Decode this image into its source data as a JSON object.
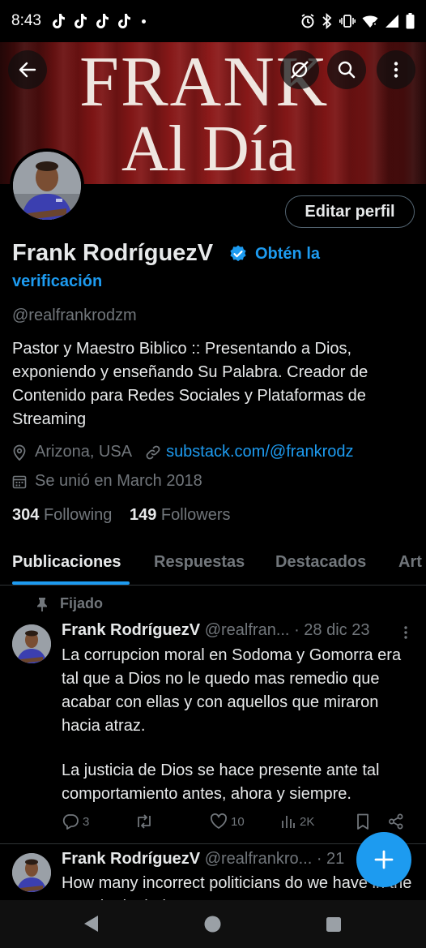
{
  "status_bar": {
    "time": "8:43"
  },
  "banner": {
    "line1": "FRANK",
    "line2": "Al Día"
  },
  "profile": {
    "edit_label": "Editar perfil",
    "name": "Frank RodríguezV",
    "verify_line1": "Obtén la",
    "verify_line2": "verificación",
    "handle": "@realfrankrodzm",
    "bio": "Pastor y Maestro Biblico :: Presentando a Dios, exponiendo y enseñando Su Palabra.  Creador de Contenido para Redes Sociales y Plataformas de Streaming",
    "location": "Arizona, USA",
    "website": "substack.com/@frankrodz",
    "joined": "Se unió en March 2018",
    "following_count": "304",
    "following_label": "Following",
    "followers_count": "149",
    "followers_label": "Followers"
  },
  "tabs": [
    "Publicaciones",
    "Respuestas",
    "Destacados",
    "Art"
  ],
  "tweets": [
    {
      "pinned_label": "Fijado",
      "name": "Frank RodríguezV",
      "handle": "@realfran...",
      "date": "· 28 dic 23",
      "text_p1": "La corrupcion moral en Sodoma y Gomorra era tal que a Dios no le quedo mas remedio que acabar con ellas y con aquellos que miraron hacia atraz.",
      "text_p2": "La justicia de Dios se hace presente ante tal comportamiento antes, ahora y siempre.",
      "replies": "3",
      "likes": "10",
      "views": "2K"
    },
    {
      "name": "Frank RodríguezV",
      "handle": "@realfrankro...",
      "date": "· 21",
      "text": "How many incorrect politicians do we have in the US who in their p..."
    }
  ],
  "colors": {
    "accent": "#1d9bf0",
    "background": "#000000",
    "muted": "#71767b"
  }
}
